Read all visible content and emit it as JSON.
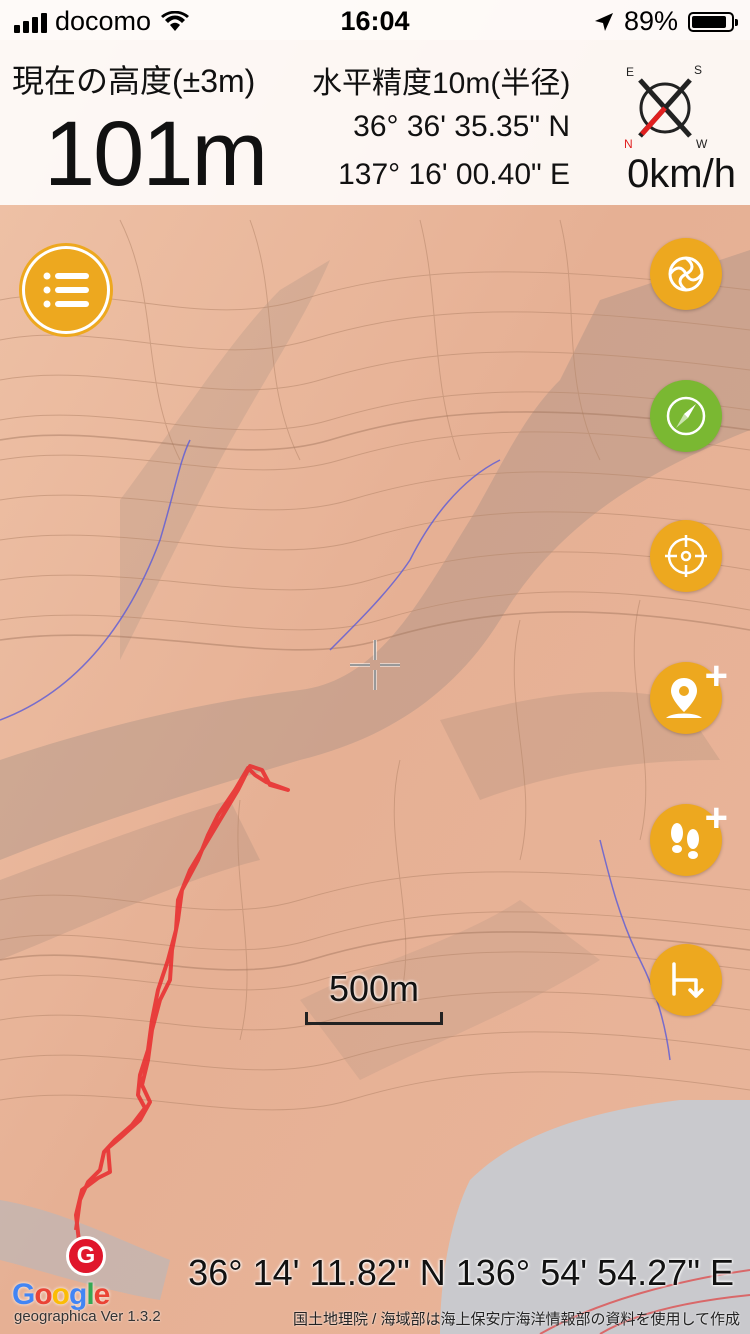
{
  "status_bar": {
    "carrier": "docomo",
    "time": "16:04",
    "battery": "89%",
    "battery_level": 0.89
  },
  "info": {
    "altitude_label": "現在の高度(±3m)",
    "altitude": "101m",
    "accuracy": "水平精度10m(半径)",
    "latitude": "36° 36' 35.35\" N",
    "longitude": "137° 16' 00.40\" E",
    "speed": "0km/h",
    "compass_letters": {
      "n": "N",
      "s": "S",
      "e": "E",
      "w": "W"
    }
  },
  "map": {
    "scale_label": "500m",
    "cursor_coordinates": "36° 14' 11.82\" N 136° 54' 54.27\" E",
    "version": "geographica Ver 1.3.2",
    "attribution": "国土地理院 / 海域部は海上保安庁海洋情報部の資料を使用して作成",
    "google": "Google",
    "colors": {
      "terrain": "#e9b79a",
      "track": "#e83232",
      "accent": "#eda81f",
      "green": "#7ab832",
      "water": "#c9c9cd"
    }
  },
  "buttons": {
    "menu": "menu-list-icon",
    "compass_mode": "spiral-icon",
    "heading": "compass-needle-icon",
    "center": "target-icon",
    "add_waypoint": "pin-plus-icon",
    "add_track": "footsteps-plus-icon",
    "return": "return-arrow-icon"
  }
}
